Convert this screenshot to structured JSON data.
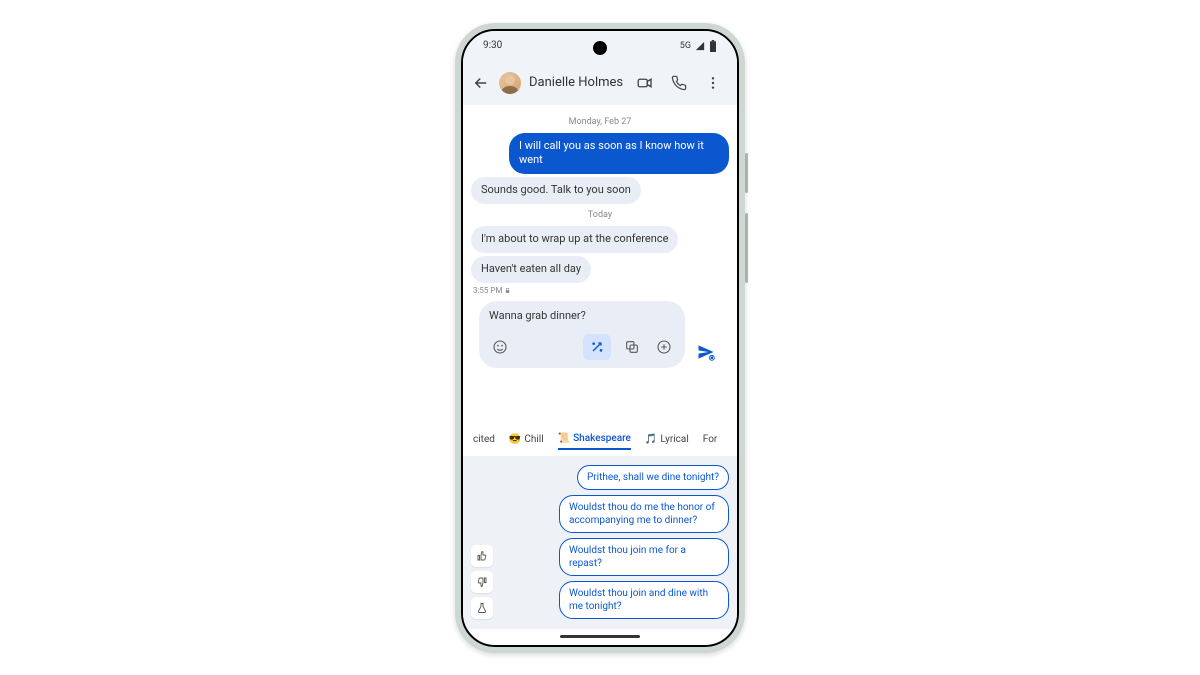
{
  "status": {
    "time": "9:30",
    "network": "5G"
  },
  "header": {
    "contact": "Danielle Holmes"
  },
  "dates": {
    "d1": "Monday, Feb 27",
    "d2": "Today"
  },
  "msgs": {
    "m1": "I will call you as soon as I know how it went",
    "m2": "Sounds good. Talk to you soon",
    "m3": "I'm about to wrap up at the conference",
    "m4": "Haven't eaten all day",
    "ts": "3:55 PM"
  },
  "compose": {
    "draft": "Wanna grab dinner?"
  },
  "tones": {
    "t0": "cited",
    "t1": "Chill",
    "t2": "Shakespeare",
    "t3": "Lyrical",
    "t4": "For"
  },
  "suggestions": {
    "s1": "Prithee, shall we dine tonight?",
    "s2": "Wouldst thou do me the honor of accompanying me to dinner?",
    "s3": "Wouldst thou join me for a repast?",
    "s4": "Wouldst thou join and dine with me tonight?"
  }
}
